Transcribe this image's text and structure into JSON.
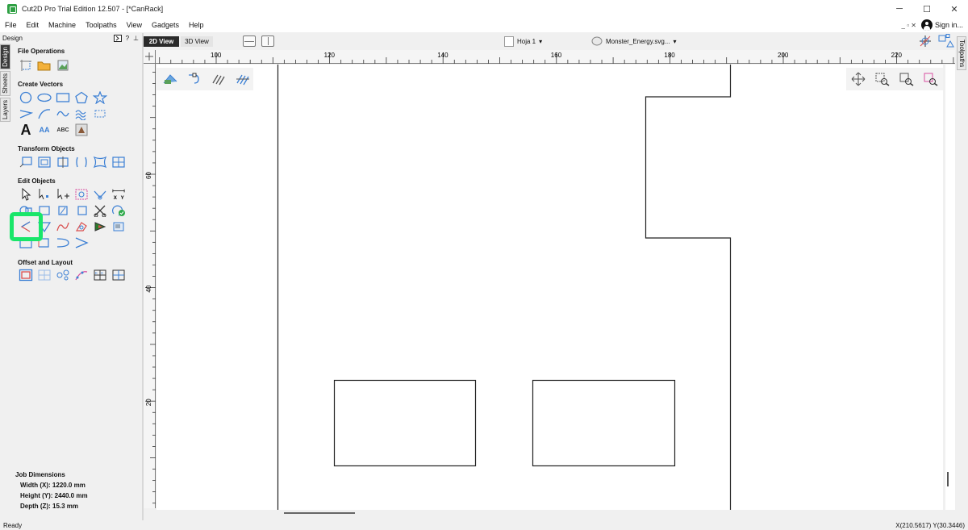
{
  "window": {
    "title": "Cut2D Pro Trial Edition 12.507 - [*CanRack]",
    "minimize": "─",
    "maximize": "☐",
    "close": "✕"
  },
  "menu": {
    "items": [
      "File",
      "Edit",
      "Machine",
      "Toolpaths",
      "View",
      "Gadgets",
      "Help"
    ],
    "restore_icons": "_ ▫ ✕",
    "sign_in": "Sign in..."
  },
  "design_panel": {
    "header": "Design",
    "header_icons": [
      "?",
      "⊥"
    ],
    "vtabs": [
      "Design",
      "Sheets",
      "Layers"
    ],
    "sections": {
      "file_operations": "File Operations",
      "create_vectors": "Create Vectors",
      "transform_objects": "Transform Objects",
      "edit_objects": "Edit Objects",
      "offset_layout": "Offset and Layout"
    },
    "create_text_icons": [
      "A",
      "AA",
      "ABC"
    ],
    "dim_xy": [
      "X",
      "Y"
    ]
  },
  "job_dimensions": {
    "title": "Job Dimensions",
    "width": "Width  (X): 1220.0 mm",
    "height": "Height (Y): 2440.0 mm",
    "depth": "Depth  (Z): 15.3 mm"
  },
  "view_toolbar": {
    "view_2d": "2D View",
    "view_3d": "3D View",
    "sheet": "Hoja 1",
    "file": "Monster_Energy.svg..."
  },
  "right_tab": "Toolpaths",
  "ruler": {
    "top_labels": [
      "100",
      "120",
      "140",
      "160",
      "180",
      "200",
      "220"
    ],
    "left_labels": [
      "60",
      "40",
      "20"
    ]
  },
  "status": {
    "left": "Ready",
    "coords": "X(210.5617) Y(30.3446)"
  },
  "colors": {
    "accent_highlight": "#19e66a",
    "icon_blue": "#3b7fd4",
    "dark_tab": "#2a2a2a"
  }
}
